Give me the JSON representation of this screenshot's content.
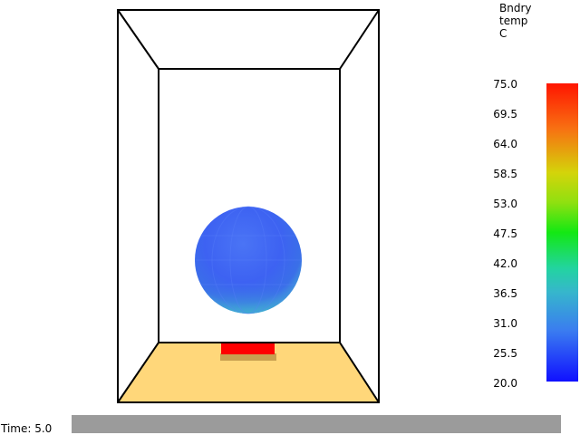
{
  "legend": {
    "title_lines": [
      "Bndry",
      "temp",
      "C"
    ],
    "ticks": [
      "75.0",
      "69.5",
      "64.0",
      "58.5",
      "53.0",
      "47.5",
      "42.0",
      "36.5",
      "31.0",
      "25.5",
      "20.0"
    ],
    "range": [
      20.0,
      75.0
    ],
    "colors": {
      "max": "#ff1500",
      "mid": "#13e813",
      "min": "#1010ff"
    }
  },
  "time": {
    "label": "Time: 5.0"
  },
  "scene": {
    "floor_color": "#ffd77a",
    "heater_color": "#ff0000",
    "heater_side_color": "#c8a050",
    "sphere_color": "#3b63f2"
  }
}
